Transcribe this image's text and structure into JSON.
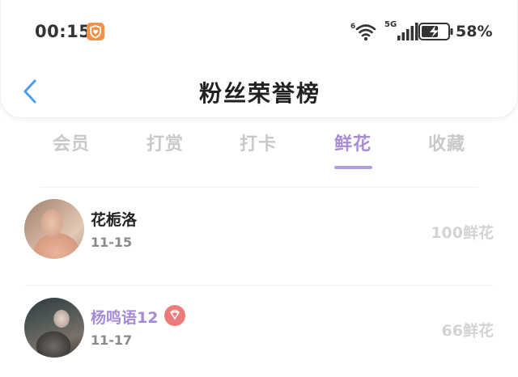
{
  "status_bar": {
    "time": "00:15",
    "network_label_top": "6",
    "network_label": "5G",
    "battery_percent": "58%",
    "app_badge_icon": "heart-shield-icon",
    "app_badge_color": "#f0924a"
  },
  "header": {
    "back_icon": "chevron-left-icon",
    "title": "粉丝荣誉榜"
  },
  "tabs": {
    "items": [
      "会员",
      "打赏",
      "打卡",
      "鲜花",
      "收藏"
    ],
    "active_index": 3,
    "active_color": "#a98bd6"
  },
  "fans": [
    {
      "name": "花栀洛",
      "date": "11-15",
      "amount": "100鲜花",
      "vip": false
    },
    {
      "name": "杨鸣语12",
      "date": "11-17",
      "amount": "66鲜花",
      "vip": true,
      "badge_icon": "diamond-icon"
    }
  ]
}
